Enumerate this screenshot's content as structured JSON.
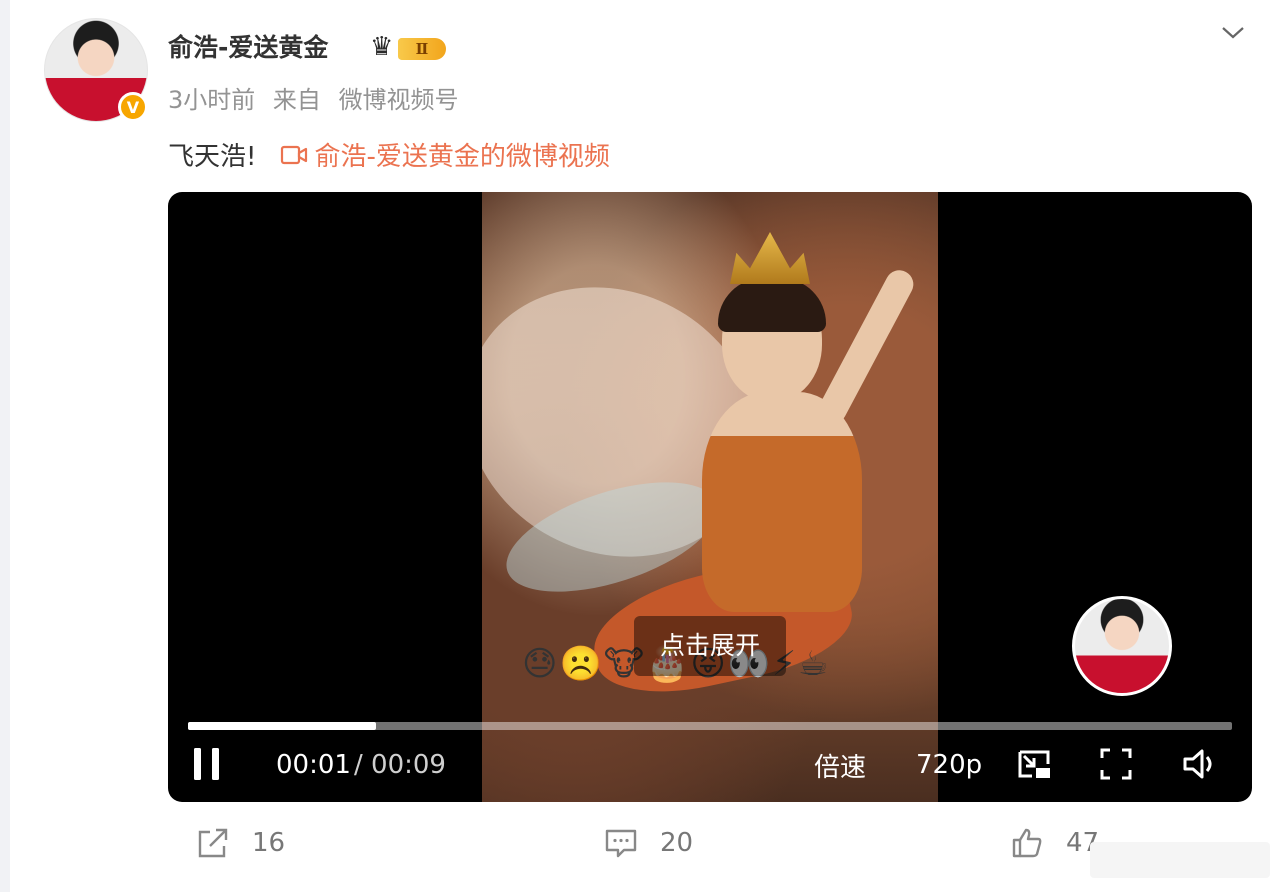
{
  "post": {
    "author": "俞浩-爱送黄金",
    "vip_level": "Ⅱ",
    "verified_mark": "V",
    "time": "3小时前",
    "source_prefix": "来自",
    "source": "微博视频号",
    "text": "飞天浩!",
    "video_link": "俞浩-爱送黄金的微博视频"
  },
  "player": {
    "expand_overlay": "点击展开",
    "danmaku_emojis": "😓☹️🐮🎂😝👀⚡☕",
    "current_time": "00:01",
    "total_time": "/ 00:09",
    "progress": 0.18,
    "speed_label": "倍速",
    "quality_label": "720p"
  },
  "actions": {
    "repost_count": "16",
    "comment_count": "20",
    "like_count": "47"
  },
  "colors": {
    "link": "#eb7350",
    "meta": "#939393",
    "vip_gold": "#f2a51c"
  }
}
